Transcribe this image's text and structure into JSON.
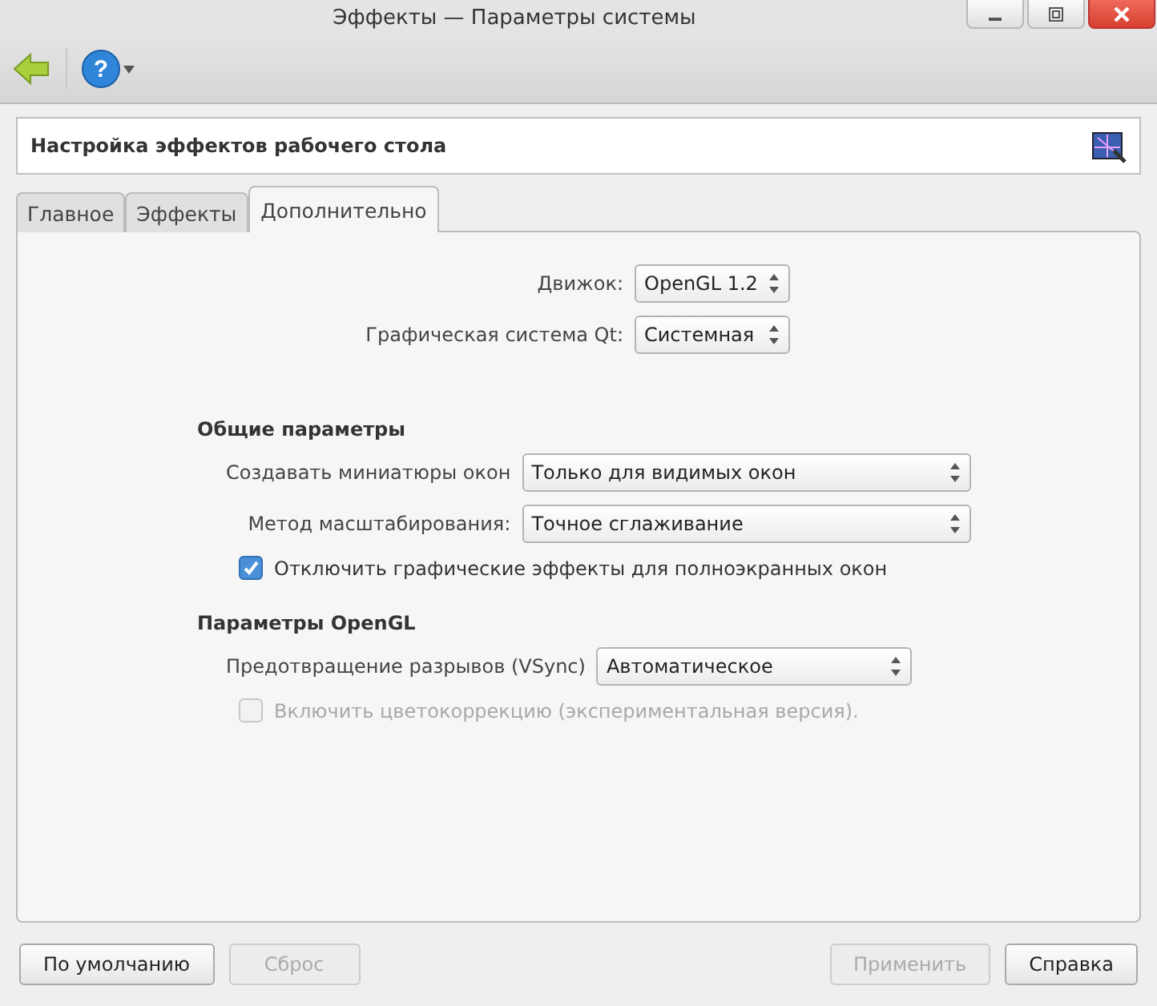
{
  "window": {
    "title": "Эффекты — Параметры системы"
  },
  "toolbar": {
    "help_glyph": "?"
  },
  "header": {
    "title": "Настройка эффектов рабочего стола"
  },
  "tabs": [
    {
      "label": "Главное",
      "selected": false
    },
    {
      "label": "Эффекты",
      "selected": false
    },
    {
      "label": "Дополнительно",
      "selected": true
    }
  ],
  "top_rows": [
    {
      "label": "Движок:",
      "value": "OpenGL 1.2"
    },
    {
      "label": "Графическая система Qt:",
      "value": "Системная"
    }
  ],
  "sections": [
    {
      "title": "Общие параметры",
      "rows": [
        {
          "kind": "combo",
          "label": "Создавать миниатюры окон",
          "value": "Только для видимых окон"
        },
        {
          "kind": "combo",
          "label": "Метод масштабирования:",
          "value": "Точное сглаживание"
        },
        {
          "kind": "checkbox",
          "label": "Отключить графические эффекты для полноэкранных окон",
          "checked": true,
          "disabled": false
        }
      ]
    },
    {
      "title": "Параметры OpenGL",
      "rows": [
        {
          "kind": "combo",
          "label": "Предотвращение разрывов (VSync)",
          "value": "Автоматическое"
        },
        {
          "kind": "checkbox",
          "label": "Включить цветокоррекцию (экспериментальная версия).",
          "checked": false,
          "disabled": true
        }
      ]
    }
  ],
  "buttons_left": [
    {
      "label": "По умолчанию",
      "disabled": false
    },
    {
      "label": "Сброс",
      "disabled": true
    }
  ],
  "buttons_right": [
    {
      "label": "Применить",
      "disabled": true
    },
    {
      "label": "Справка",
      "disabled": false
    }
  ]
}
